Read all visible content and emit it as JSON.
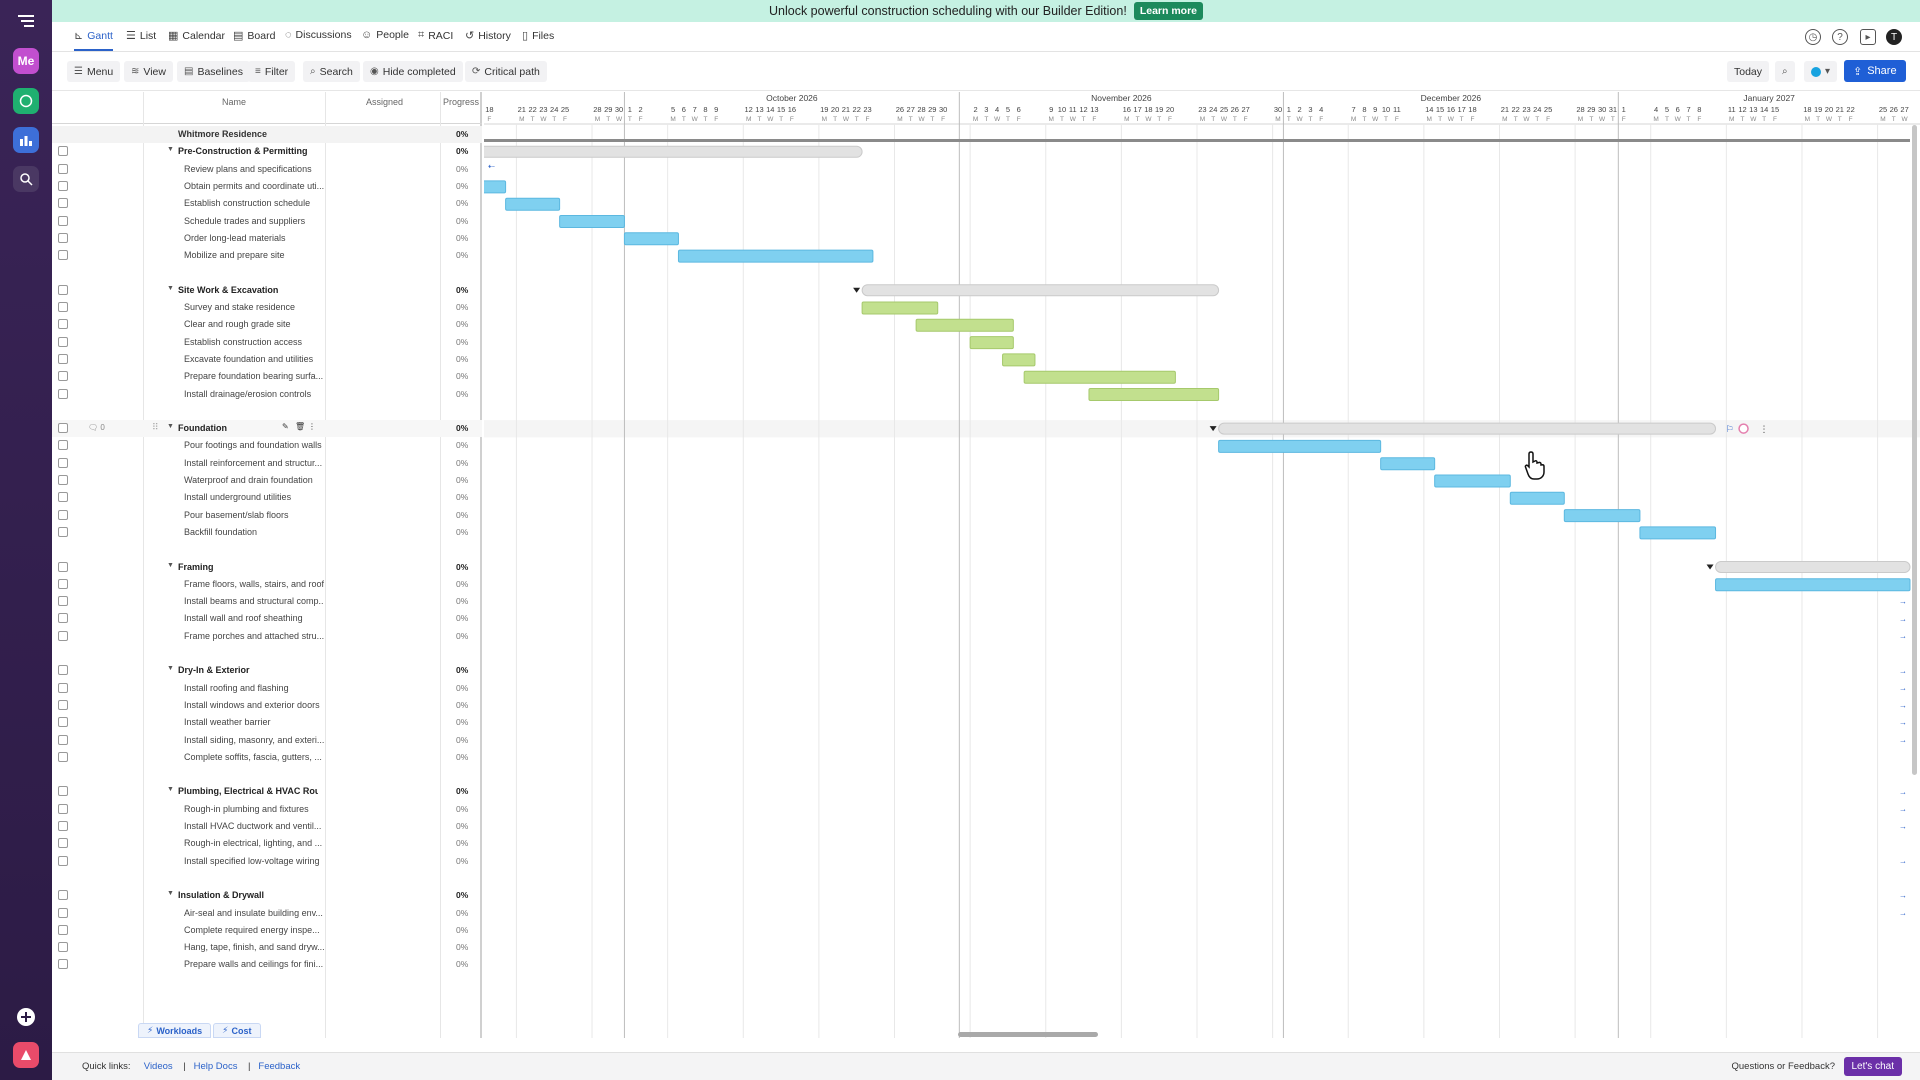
{
  "banner": {
    "text": "Unlock powerful construction scheduling with our Builder Edition!",
    "cta": "Learn more"
  },
  "rail": {
    "me_label": "Me"
  },
  "tabs": [
    {
      "label": "Gantt",
      "icon": "gantt-icon",
      "active": true
    },
    {
      "label": "List",
      "icon": "list-icon"
    },
    {
      "label": "Calendar",
      "icon": "calendar-icon"
    },
    {
      "label": "Board",
      "icon": "board-icon"
    },
    {
      "label": "Discussions",
      "icon": "discussions-icon"
    },
    {
      "label": "People",
      "icon": "people-icon"
    },
    {
      "label": "RACI",
      "icon": "raci-icon"
    },
    {
      "label": "History",
      "icon": "history-icon"
    },
    {
      "label": "Files",
      "icon": "files-icon"
    }
  ],
  "user_initial": "T",
  "toolbar": {
    "menu": "Menu",
    "view": "View",
    "baselines": "Baselines",
    "filter": "Filter",
    "search": "Search",
    "hide_completed": "Hide completed",
    "critical_path": "Critical path",
    "today": "Today",
    "share": "Share"
  },
  "columns": {
    "name": "Name",
    "assigned": "Assigned",
    "progress": "Progress"
  },
  "foundation_comment_count": "0",
  "rows": [
    {
      "type": "root",
      "name": "Whitmore Residence",
      "progress": "0%"
    },
    {
      "type": "group",
      "name": "Pre-Construction & Permitting",
      "progress": "0%"
    },
    {
      "type": "task",
      "name": "Review plans and specifications",
      "progress": "0%"
    },
    {
      "type": "task",
      "name": "Obtain permits and coordinate uti...",
      "progress": "0%"
    },
    {
      "type": "task",
      "name": "Establish construction schedule",
      "progress": "0%"
    },
    {
      "type": "task",
      "name": "Schedule trades and suppliers",
      "progress": "0%"
    },
    {
      "type": "task",
      "name": "Order long-lead materials",
      "progress": "0%"
    },
    {
      "type": "task",
      "name": "Mobilize and prepare site",
      "progress": "0%"
    },
    {
      "type": "spacer"
    },
    {
      "type": "group",
      "name": "Site Work & Excavation",
      "progress": "0%"
    },
    {
      "type": "task",
      "name": "Survey and stake residence",
      "progress": "0%"
    },
    {
      "type": "task",
      "name": "Clear and rough grade site",
      "progress": "0%"
    },
    {
      "type": "task",
      "name": "Establish construction access",
      "progress": "0%"
    },
    {
      "type": "task",
      "name": "Excavate foundation and utilities",
      "progress": "0%"
    },
    {
      "type": "task",
      "name": "Prepare foundation bearing surfa...",
      "progress": "0%"
    },
    {
      "type": "task",
      "name": "Install drainage/erosion controls",
      "progress": "0%"
    },
    {
      "type": "spacer"
    },
    {
      "type": "group",
      "name": "Foundation",
      "progress": "0%",
      "hover": true
    },
    {
      "type": "task",
      "name": "Pour footings and foundation walls",
      "progress": "0%"
    },
    {
      "type": "task",
      "name": "Install reinforcement and structur...",
      "progress": "0%"
    },
    {
      "type": "task",
      "name": "Waterproof and drain foundation",
      "progress": "0%"
    },
    {
      "type": "task",
      "name": "Install underground utilities",
      "progress": "0%"
    },
    {
      "type": "task",
      "name": "Pour basement/slab floors",
      "progress": "0%"
    },
    {
      "type": "task",
      "name": "Backfill foundation",
      "progress": "0%"
    },
    {
      "type": "spacer"
    },
    {
      "type": "group",
      "name": "Framing",
      "progress": "0%"
    },
    {
      "type": "task",
      "name": "Frame floors, walls, stairs, and roof",
      "progress": "0%"
    },
    {
      "type": "task",
      "name": "Install beams and structural comp...",
      "progress": "0%"
    },
    {
      "type": "task",
      "name": "Install wall and roof sheathing",
      "progress": "0%"
    },
    {
      "type": "task",
      "name": "Frame porches and attached stru...",
      "progress": "0%"
    },
    {
      "type": "spacer"
    },
    {
      "type": "group",
      "name": "Dry-In & Exterior",
      "progress": "0%"
    },
    {
      "type": "task",
      "name": "Install roofing and flashing",
      "progress": "0%"
    },
    {
      "type": "task",
      "name": "Install windows and exterior doors",
      "progress": "0%"
    },
    {
      "type": "task",
      "name": "Install weather barrier",
      "progress": "0%"
    },
    {
      "type": "task",
      "name": "Install siding, masonry, and exteri...",
      "progress": "0%"
    },
    {
      "type": "task",
      "name": "Complete soffits, fascia, gutters, ...",
      "progress": "0%"
    },
    {
      "type": "spacer"
    },
    {
      "type": "group",
      "name": "Plumbing, Electrical & HVAC Rou...",
      "progress": "0%"
    },
    {
      "type": "task",
      "name": "Rough-in plumbing and fixtures",
      "progress": "0%"
    },
    {
      "type": "task",
      "name": "Install HVAC ductwork and ventil...",
      "progress": "0%"
    },
    {
      "type": "task",
      "name": "Rough-in electrical, lighting, and ...",
      "progress": "0%"
    },
    {
      "type": "task",
      "name": "Install specified low-voltage wiring",
      "progress": "0%"
    },
    {
      "type": "spacer"
    },
    {
      "type": "group",
      "name": "Insulation & Drywall",
      "progress": "0%"
    },
    {
      "type": "task",
      "name": "Air-seal and insulate building env...",
      "progress": "0%"
    },
    {
      "type": "task",
      "name": "Complete required energy inspe...",
      "progress": "0%"
    },
    {
      "type": "task",
      "name": "Hang, tape, finish, and sand dryw...",
      "progress": "0%"
    },
    {
      "type": "task",
      "name": "Prepare walls and ceilings for fini...",
      "progress": "0%"
    }
  ],
  "timeline": {
    "months": [
      {
        "label": "October 2026",
        "start": "2026-10-01"
      },
      {
        "label": "November 2026",
        "start": "2026-11-01"
      },
      {
        "label": "December 2026",
        "start": "2026-12-01"
      },
      {
        "label": "January 2027",
        "start": "2027-01-01"
      }
    ],
    "view_start": "2026-09-18",
    "view_end": "2027-01-27"
  },
  "bars": [
    {
      "row": 1,
      "start": "2026-09-14",
      "end": "2026-10-23",
      "kind": "summary"
    },
    {
      "row": 3,
      "start": "2026-09-14",
      "end": "2026-09-20",
      "kind": "blue"
    },
    {
      "row": 4,
      "start": "2026-09-20",
      "end": "2026-09-25",
      "kind": "blue"
    },
    {
      "row": 5,
      "start": "2026-09-25",
      "end": "2026-10-01",
      "kind": "blue"
    },
    {
      "row": 6,
      "start": "2026-10-01",
      "end": "2026-10-06",
      "kind": "blue"
    },
    {
      "row": 7,
      "start": "2026-10-06",
      "end": "2026-10-24",
      "kind": "blue"
    },
    {
      "row": 9,
      "start": "2026-10-23",
      "end": "2026-11-25",
      "kind": "summary"
    },
    {
      "row": 10,
      "start": "2026-10-23",
      "end": "2026-10-30",
      "kind": "green"
    },
    {
      "row": 11,
      "start": "2026-10-28",
      "end": "2026-11-06",
      "kind": "green"
    },
    {
      "row": 12,
      "start": "2026-11-02",
      "end": "2026-11-06",
      "kind": "green"
    },
    {
      "row": 13,
      "start": "2026-11-05",
      "end": "2026-11-08",
      "kind": "green"
    },
    {
      "row": 14,
      "start": "2026-11-07",
      "end": "2026-11-21",
      "kind": "green"
    },
    {
      "row": 15,
      "start": "2026-11-13",
      "end": "2026-11-25",
      "kind": "green"
    },
    {
      "row": 17,
      "start": "2026-11-25",
      "end": "2026-01-10",
      "kind": "summary"
    },
    {
      "row": 18,
      "start": "2026-11-25",
      "end": "2026-12-10",
      "kind": "blue"
    },
    {
      "row": 19,
      "start": "2026-12-10",
      "end": "2026-12-15",
      "kind": "blue"
    },
    {
      "row": 20,
      "start": "2026-12-15",
      "end": "2026-12-22",
      "kind": "blue"
    },
    {
      "row": 21,
      "start": "2026-12-22",
      "end": "2026-12-27",
      "kind": "blue"
    },
    {
      "row": 22,
      "start": "2026-12-27",
      "end": "2027-01-03",
      "kind": "blue"
    },
    {
      "row": 23,
      "start": "2027-01-03",
      "end": "2027-01-10",
      "kind": "blue"
    },
    {
      "row": 25,
      "start": "2027-01-10",
      "end": "2027-02-01",
      "kind": "summary"
    },
    {
      "row": 26,
      "start": "2027-01-10",
      "end": "2027-02-01",
      "kind": "blue"
    }
  ],
  "bottom_tabs": {
    "workloads": "Workloads",
    "cost": "Cost"
  },
  "footer": {
    "quick_links": "Quick links:",
    "videos": "Videos",
    "help_docs": "Help Docs",
    "feedback": "Feedback",
    "questions": "Questions or Feedback?",
    "chat": "Let's chat"
  },
  "colors": {
    "blue_bar": "#7fd0f0",
    "green_bar": "#c2e08e",
    "summary_bar": "#e2e2e2",
    "accent": "#1f5fd6"
  }
}
